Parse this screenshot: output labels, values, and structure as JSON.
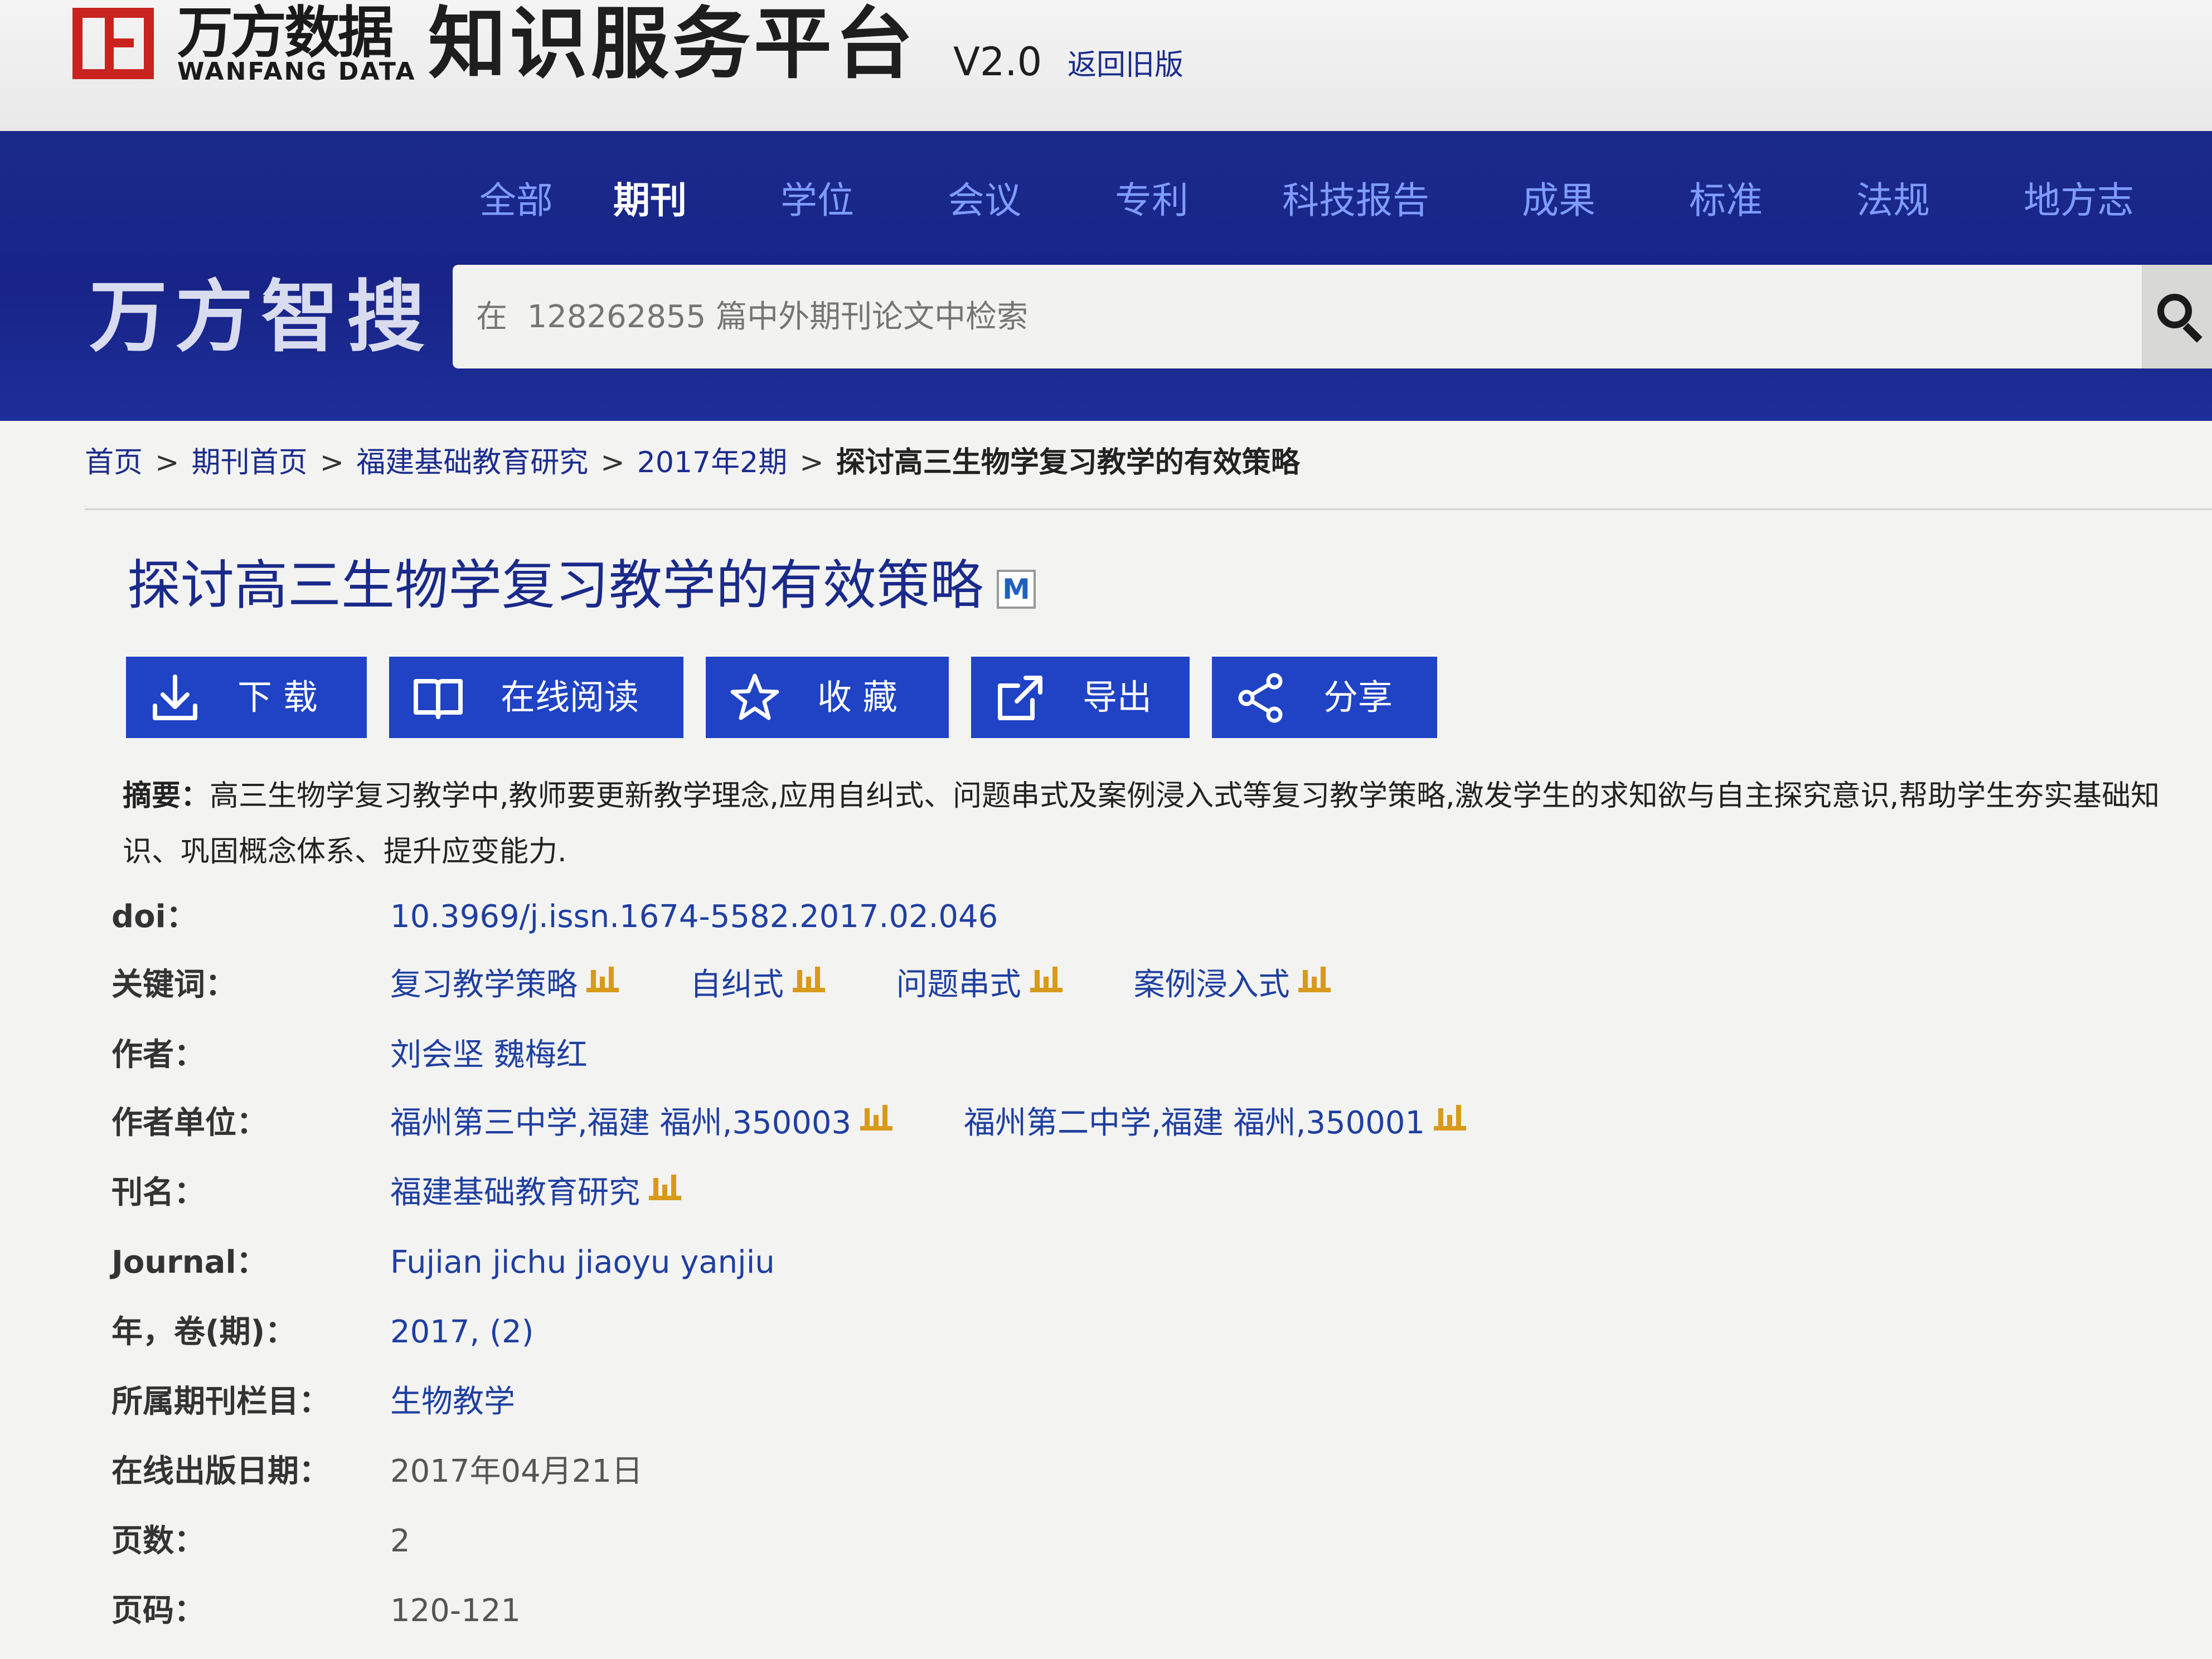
{
  "brand": {
    "logo_cn": "万方数据",
    "logo_en": "WANFANG DATA",
    "platform": "知识服务平台",
    "version": "V2.0",
    "back_old": "返回旧版"
  },
  "nav": {
    "items": [
      "全部",
      "期刊",
      "学位",
      "会议",
      "专利",
      "科技报告",
      "成果",
      "标准",
      "法规",
      "地方志"
    ],
    "active": "期刊"
  },
  "search": {
    "brand": "万方智搜",
    "placeholder": "在  128262855 篇中外期刊论文中检索"
  },
  "breadcrumb": {
    "items": [
      "首页",
      "期刊首页",
      "福建基础教育研究",
      "2017年2期"
    ],
    "separator": ">",
    "current": "探讨高三生物学复习教学的有效策略"
  },
  "article": {
    "title": "探讨高三生物学复习教学的有效策略",
    "badge": "M"
  },
  "actions": {
    "download": "下 载",
    "read_online": "在线阅读",
    "favorite": "收 藏",
    "export": "导出",
    "share": "分享"
  },
  "abstract": {
    "label": "摘要：",
    "text": "高三生物学复习教学中,教师要更新教学理念,应用自纠式、问题串式及案例浸入式等复习教学策略,激发学生的求知欲与自主探究意识,帮助学生夯实基础知识、巩固概念体系、提升应变能力."
  },
  "meta": {
    "doi_label": "doi：",
    "doi": "10.3969/j.issn.1674-5582.2017.02.046",
    "keywords_label": "关键词：",
    "keywords": [
      "复习教学策略",
      "自纠式",
      "问题串式",
      "案例浸入式"
    ],
    "authors_label": "作者：",
    "authors": "刘会坚 魏梅红",
    "affiliations_label": "作者单位：",
    "affiliations": [
      "福州第三中学,福建 福州,350003",
      "福州第二中学,福建 福州,350001"
    ],
    "journal_cn_label": "刊名：",
    "journal_cn": "福建基础教育研究",
    "journal_en_label": "Journal：",
    "journal_en": "Fujian jichu jiaoyu yanjiu",
    "year_issue_label": "年，卷(期)：",
    "year_issue": "2017, (2)",
    "column_label": "所属期刊栏目：",
    "column": "生物教学",
    "pub_date_label": "在线出版日期：",
    "pub_date": "2017年04月21日",
    "page_count_label": "页数：",
    "page_count": "2",
    "page_range_label": "页码：",
    "page_range": "120-121"
  }
}
